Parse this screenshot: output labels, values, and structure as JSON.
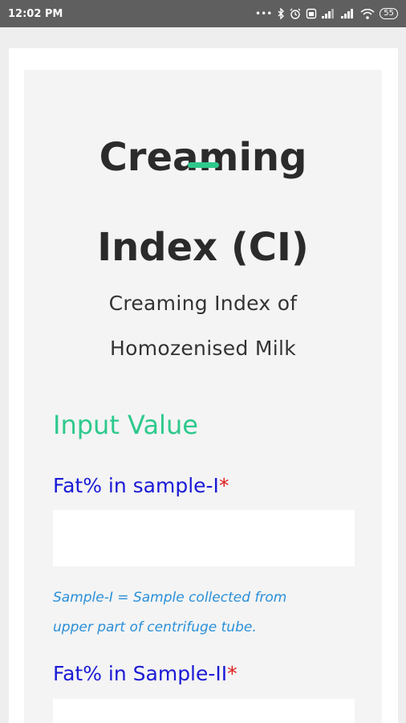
{
  "status_bar": {
    "time": "12:02 PM",
    "icons": [
      "more-dots-icon",
      "bluetooth-icon",
      "alarm-icon",
      "sim-icon",
      "signal-icon",
      "signal-icon",
      "wifi-icon"
    ],
    "battery": "55"
  },
  "header": {
    "title_line1": "Creaming",
    "title_line2": "Index (CI)",
    "subtitle_line1": "Creaming Index of",
    "subtitle_line2": "Homozenised Milk"
  },
  "form": {
    "section_heading": "Input Value",
    "fields": [
      {
        "label": "Fat% in sample-I",
        "required_mark": "*",
        "value": "",
        "placeholder": ""
      },
      {
        "label": "Fat% in Sample-II",
        "required_mark": "*",
        "value": "",
        "placeholder": ""
      }
    ],
    "hint_line1": "Sample-I = Sample collected from",
    "hint_line2": "upper part of centrifuge tube."
  },
  "colors": {
    "accent_green": "#2ec98c",
    "label_blue": "#1a1ad6",
    "hint_blue": "#2a8fd9",
    "required_red": "#e01b1b"
  }
}
